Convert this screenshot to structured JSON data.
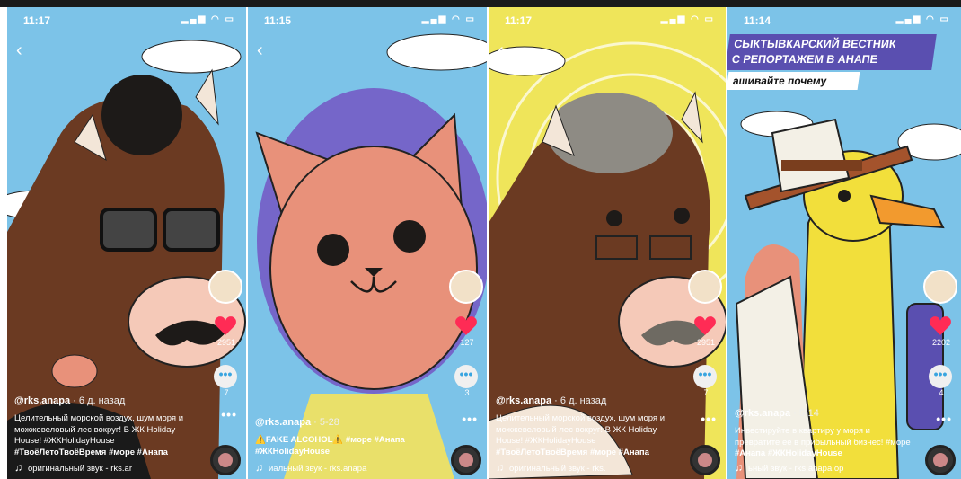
{
  "screens": [
    {
      "time": "11:17",
      "likes": "2951",
      "comments": "7",
      "username": "@rks.anapa",
      "ago": "6 д. назад",
      "caption_lines": [
        "Целительный морской воздух, шум моря и",
        "можжевеловый лес вокруг! В ЖК Holiday",
        "House! #ЖКHolidayHouse",
        "#ТвоёЛетоТвоёВремя #море #Анапа"
      ],
      "sound": "оригинальный звук - rks.ar"
    },
    {
      "time": "11:15",
      "likes": "127",
      "comments": "3",
      "username": "@rks.anapa",
      "ago": "5-28",
      "caption_lines": [
        "⚠️FAKE ALCOHOL⚠️ #море #Анапа",
        "#ЖКHolidayHouse"
      ],
      "sound": "иальный звук - rks.anapa"
    },
    {
      "time": "11:17",
      "likes": "2951",
      "comments": "7",
      "username": "@rks.anapa",
      "ago": "6 д. назад",
      "caption_lines": [
        "Целительный морской воздух, шум моря и",
        "можжевеловый лес вокруг! В ЖК Holiday",
        "House! #ЖКHolidayHouse",
        "#ТвоёЛетоТвоёВремя #море #Анапа"
      ],
      "sound": "оригинальный звук - rks."
    },
    {
      "time": "11:14",
      "likes": "2202",
      "comments": "4",
      "username": "@rks.anapa",
      "ago": "5-14",
      "caption_lines": [
        "Инвестируйте в квартиру у моря и",
        "превратите ее в прибыльный бизнес! #море",
        "#Анапа #ЖКHolidayHouse"
      ],
      "sound": "ьный звук - rks.anapa   ор",
      "banner_line1": "СЫКТЫВКАРСКИЙ ВЕСТНИК",
      "banner_line2": "С РЕПОРТАЖЕМ В АНАПЕ",
      "banner_line3": "ашивайте почему"
    }
  ],
  "colors": {
    "sky": "#7cc3e8",
    "bull_brown": "#6b3a22",
    "cat_pink": "#e8917a",
    "cat_hair": "#7566c9",
    "sun_yellow": "#efe55a",
    "duck_yellow": "#f2df3b",
    "heart": "#ff2b55",
    "banner": "#5a4fb0"
  }
}
